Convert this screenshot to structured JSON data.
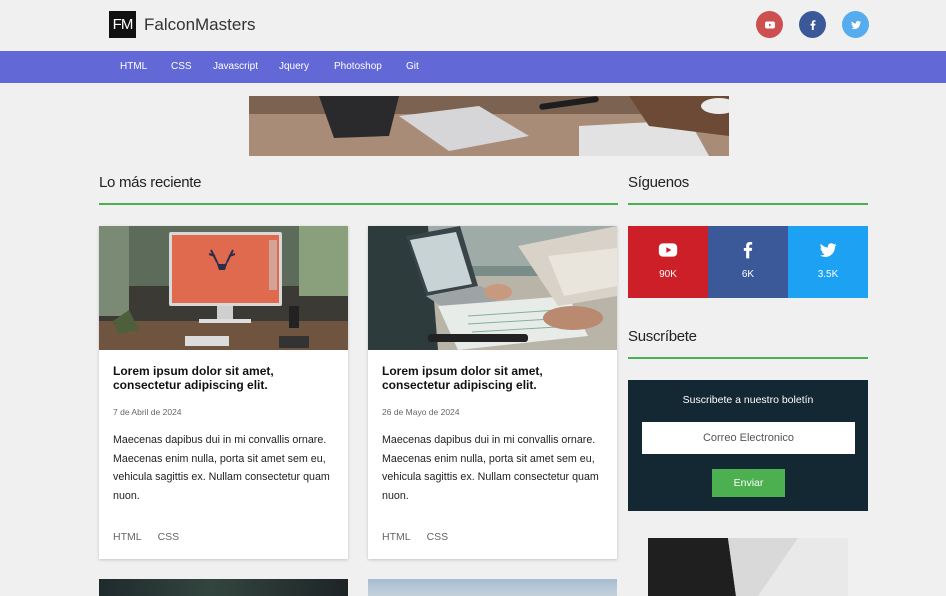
{
  "header": {
    "logo_mark": "FM",
    "logo_text": "FalconMasters",
    "social_icons": [
      {
        "name": "youtube-icon",
        "color": "#cd4f4f"
      },
      {
        "name": "facebook-icon",
        "color": "#3b5998"
      },
      {
        "name": "twitter-icon",
        "color": "#55acee"
      }
    ]
  },
  "nav": {
    "items": [
      "HTML",
      "CSS",
      "Javascript",
      "Jquery",
      "Photoshop",
      "Git"
    ],
    "color": "#6268d6"
  },
  "main": {
    "title": "Lo más reciente",
    "posts": [
      {
        "title": "Lorem ipsum dolor sit amet, consectetur adipiscing elit.",
        "date": "7 de Abril de 2024",
        "excerpt": "Maecenas dapibus dui in mi convallis ornare. Maecenas enim nulla, porta sit amet sem eu, vehicula sagittis ex. Nullam consectetur quam nuon.",
        "tags": [
          "HTML",
          "CSS"
        ]
      },
      {
        "title": "Lorem ipsum dolor sit amet, consectetur adipiscing elit.",
        "date": "26 de Mayo de 2024",
        "excerpt": "Maecenas dapibus dui in mi convallis ornare. Maecenas enim nulla, porta sit amet sem eu, vehicula sagittis ex. Nullam consectetur quam nuon.",
        "tags": [
          "HTML",
          "CSS"
        ]
      }
    ]
  },
  "sidebar": {
    "follow_title": "Síguenos",
    "social": [
      {
        "icon": "youtube-icon",
        "count": "90K",
        "color": "#cd1f27"
      },
      {
        "icon": "facebook-icon",
        "count": "6K",
        "color": "#3b5998"
      },
      {
        "icon": "twitter-icon",
        "count": "3.5K",
        "color": "#1da1f2"
      }
    ],
    "subscribe_title": "Suscríbete",
    "newsletter": {
      "title": "Suscribete a nuestro boletín",
      "placeholder": "Correo Electronico",
      "button": "Enviar"
    }
  },
  "accent_color": "#4caf50"
}
